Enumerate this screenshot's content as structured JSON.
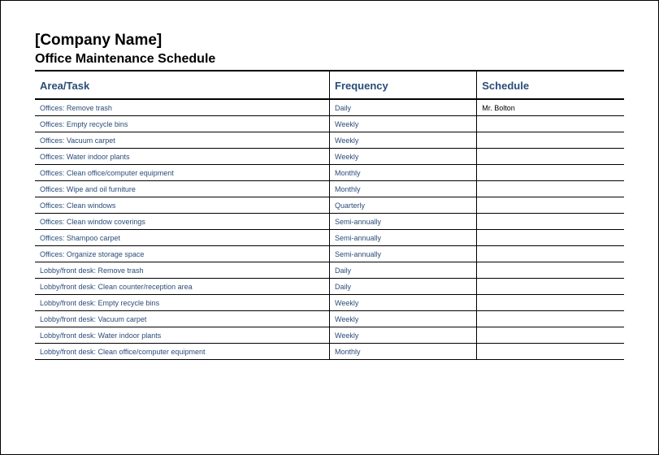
{
  "header": {
    "company_name": "[Company Name]",
    "subtitle": "Office Maintenance Schedule"
  },
  "columns": {
    "area_task": "Area/Task",
    "frequency": "Frequency",
    "schedule": "Schedule"
  },
  "rows": [
    {
      "area_task": "Offices: Remove trash",
      "frequency": "Daily",
      "schedule": "Mr. Bolton"
    },
    {
      "area_task": "Offices: Empty recycle bins",
      "frequency": "Weekly",
      "schedule": ""
    },
    {
      "area_task": "Offices: Vacuum carpet",
      "frequency": "Weekly",
      "schedule": ""
    },
    {
      "area_task": "Offices: Water indoor plants",
      "frequency": "Weekly",
      "schedule": ""
    },
    {
      "area_task": "Offices: Clean office/computer equipment",
      "frequency": "Monthly",
      "schedule": ""
    },
    {
      "area_task": "Offices: Wipe and oil furniture",
      "frequency": "Monthly",
      "schedule": ""
    },
    {
      "area_task": "Offices: Clean windows",
      "frequency": "Quarterly",
      "schedule": ""
    },
    {
      "area_task": "Offices: Clean window coverings",
      "frequency": "Semi-annually",
      "schedule": ""
    },
    {
      "area_task": "Offices: Shampoo carpet",
      "frequency": "Semi-annually",
      "schedule": ""
    },
    {
      "area_task": "Offices: Organize storage space",
      "frequency": "Semi-annually",
      "schedule": ""
    },
    {
      "area_task": "Lobby/front desk: Remove trash",
      "frequency": "Daily",
      "schedule": ""
    },
    {
      "area_task": "Lobby/front desk: Clean counter/reception area",
      "frequency": "Daily",
      "schedule": ""
    },
    {
      "area_task": "Lobby/front desk: Empty recycle bins",
      "frequency": "Weekly",
      "schedule": ""
    },
    {
      "area_task": "Lobby/front desk: Vacuum carpet",
      "frequency": "Weekly",
      "schedule": ""
    },
    {
      "area_task": "Lobby/front desk: Water indoor plants",
      "frequency": "Weekly",
      "schedule": ""
    },
    {
      "area_task": "Lobby/front desk: Clean office/computer equipment",
      "frequency": "Monthly",
      "schedule": ""
    }
  ]
}
